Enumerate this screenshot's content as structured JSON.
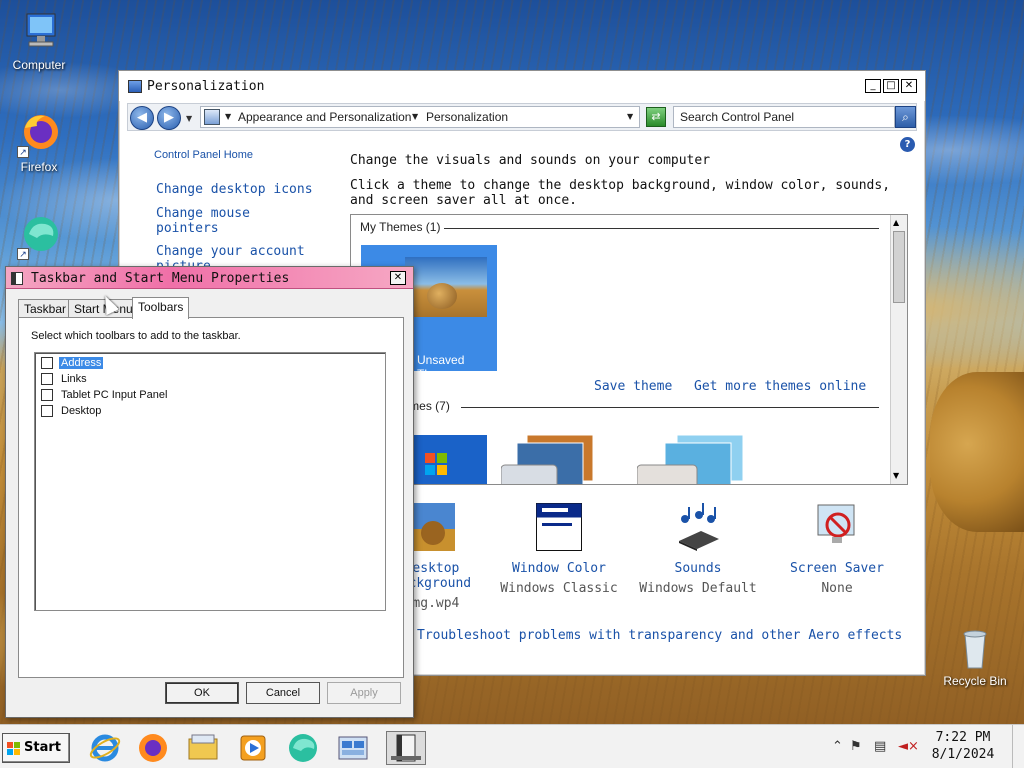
{
  "desktop": {
    "icons": [
      {
        "label": "Computer",
        "icon": "computer-icon"
      },
      {
        "label": "Firefox",
        "icon": "firefox-icon"
      },
      {
        "label": "",
        "icon": "edge-icon"
      },
      {
        "label": "Recycle Bin",
        "icon": "recycle-bin-icon"
      }
    ]
  },
  "personalization": {
    "title": "Personalization",
    "window_buttons": {
      "minimize": "_",
      "maximize": "□",
      "close": "✕"
    },
    "address": {
      "segment1": "Appearance and Personalization",
      "segment2": "Personalization"
    },
    "search_placeholder": "Search Control Panel",
    "sidebar": {
      "home": "Control Panel Home",
      "links": [
        "Change desktop icons",
        "Change mouse pointers",
        "Change your account picture"
      ]
    },
    "heading": "Change the visuals and sounds on your computer",
    "description": "Click a theme to change the desktop background, window color, sounds, and screen saver all at once.",
    "my_themes_label": "My Themes (1)",
    "unsaved_theme": "Unsaved Theme",
    "save_theme": "Save theme",
    "get_more_themes": "Get more themes online",
    "aero_themes_label": "Aero Themes (7)",
    "settings": [
      {
        "label": "Desktop Background",
        "sub": "img.wp4",
        "icon": "desktop-background-icon"
      },
      {
        "label": "Window Color",
        "sub": "Windows Classic",
        "icon": "window-color-icon"
      },
      {
        "label": "Sounds",
        "sub": "Windows Default",
        "icon": "sounds-icon"
      },
      {
        "label": "Screen Saver",
        "sub": "None",
        "icon": "screen-saver-icon"
      }
    ],
    "troubleshoot": "Troubleshoot problems with transparency and other Aero effects"
  },
  "taskbar_dialog": {
    "title": "Taskbar and Start Menu Properties",
    "tabs": [
      "Taskbar",
      "Start Menu",
      "Toolbars"
    ],
    "active_tab": "Toolbars",
    "instructions": "Select which toolbars to add to the taskbar.",
    "toolbars": [
      {
        "label": "Address",
        "checked": false,
        "selected": true
      },
      {
        "label": "Links",
        "checked": false,
        "selected": false
      },
      {
        "label": "Tablet PC Input Panel",
        "checked": false,
        "selected": false
      },
      {
        "label": "Desktop",
        "checked": false,
        "selected": false
      }
    ],
    "buttons": {
      "ok": "OK",
      "cancel": "Cancel",
      "apply": "Apply"
    }
  },
  "taskbar": {
    "start_label": "Start",
    "apps": [
      "internet-explorer-icon",
      "firefox-icon",
      "file-explorer-icon",
      "media-player-icon",
      "edge-icon",
      "control-panel-icon",
      "taskbar-properties-icon"
    ],
    "time": "7:22 PM",
    "date": "8/1/2024"
  },
  "colors": {
    "link": "#1a52a8",
    "selection": "#3c8ae6",
    "dialog_title_gradient": "#f070a8"
  }
}
